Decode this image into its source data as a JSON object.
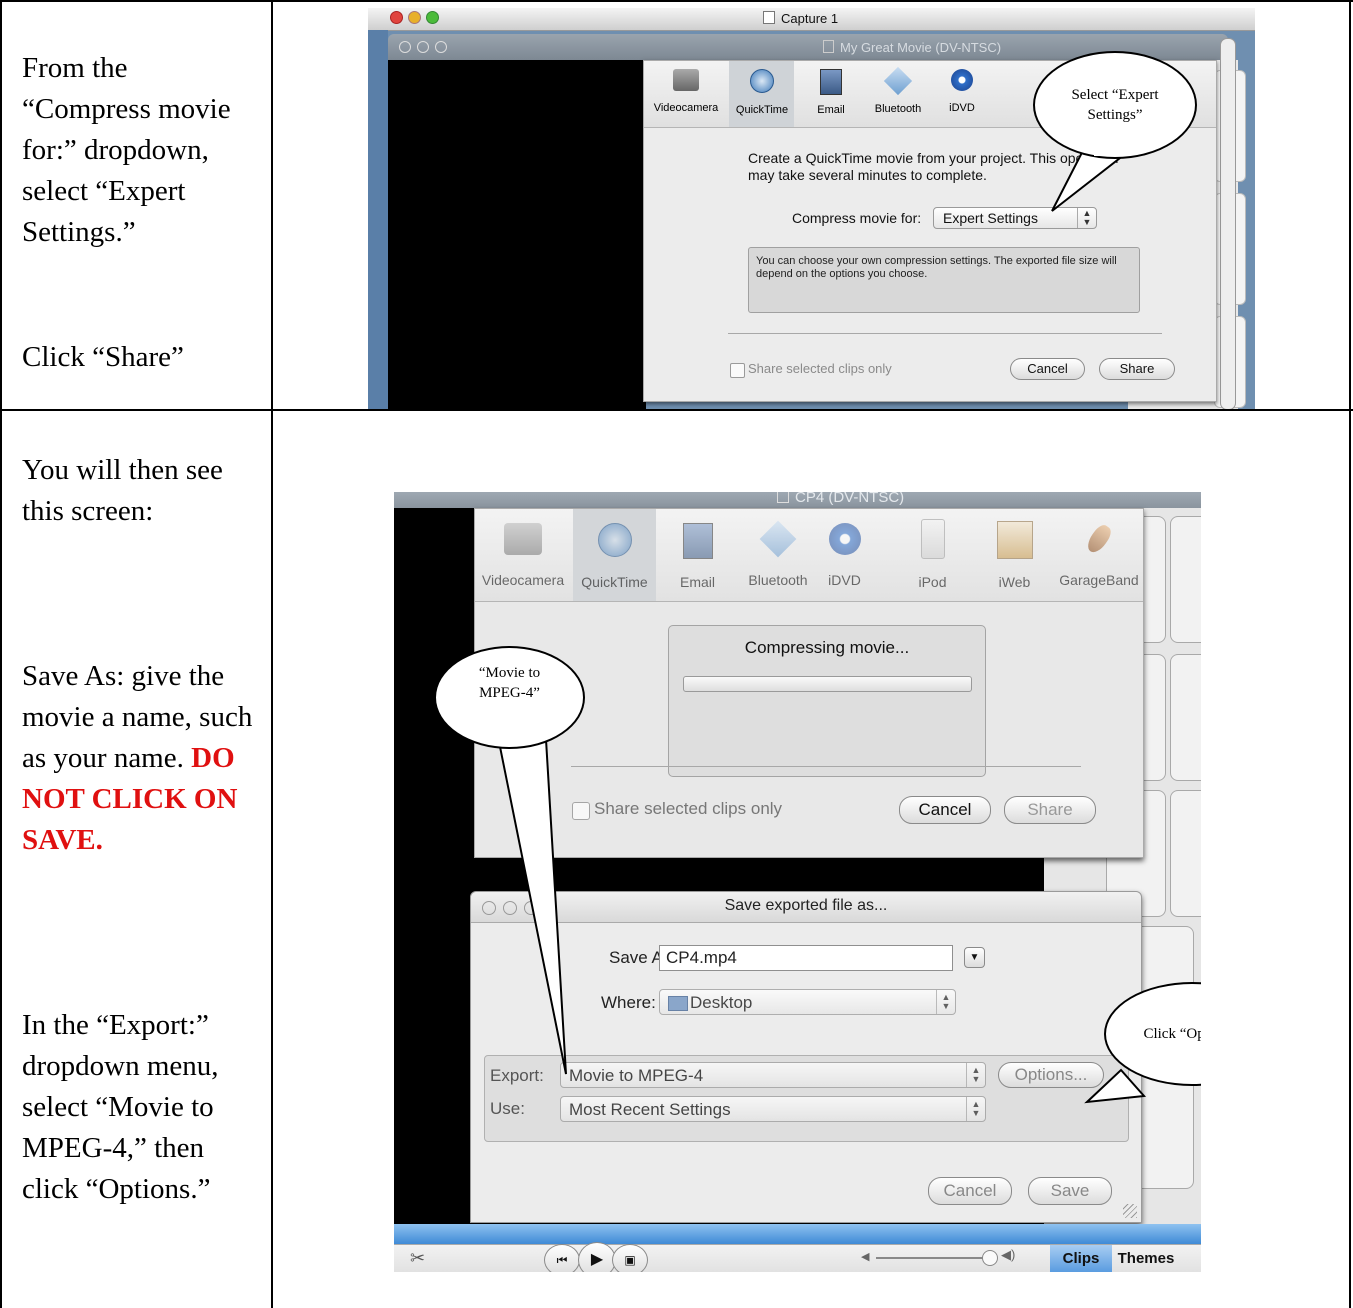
{
  "instructions": {
    "row1_compress": "From the “Compress movie for:” dropdown, select “Expert Settings.”",
    "row1_share": "Click “Share”",
    "row2_intro": "You will then see this screen:",
    "row2_save_as": "Save As:  give the movie a name, such as your name.",
    "row2_warning": "DO NOT CLICK ON SAVE.",
    "row2_export": "In the “Export:” dropdown menu, select “Movie to MPEG-4,” then click “Options.”"
  },
  "screenshot1": {
    "outer_title": "Capture 1",
    "window_title": "My Great Movie (DV-NTSC)",
    "toolbar": [
      "Videocamera",
      "QuickTime",
      "Email",
      "Bluetooth",
      "iDVD"
    ],
    "description": "Create a QuickTime movie from your project. This operation may take several minutes to complete.",
    "compress_label": "Compress movie for:",
    "compress_value": "Expert Settings",
    "info_text": "You can choose your own compression settings. The exported file size will depend on the options you choose.",
    "share_selected": "Share selected clips only",
    "cancel": "Cancel",
    "share": "Share",
    "callout": "Select “Expert Settings”"
  },
  "screenshot2": {
    "window_title": "CP4 (DV-NTSC)",
    "toolbar": [
      "Videocamera",
      "QuickTime",
      "Email",
      "Bluetooth",
      "iDVD",
      "iPod",
      "iWeb",
      "GarageBand"
    ],
    "compressing": "Compressing movie...",
    "progress": 0,
    "share_selected": "Share selected clips only",
    "cancel": "Cancel",
    "share": "Share",
    "save_dialog": {
      "title": "Save exported file as...",
      "save_as_label": "Save As:",
      "save_as_value": "CP4.mp4",
      "where_label": "Where:",
      "where_value": "Desktop",
      "export_label": "Export:",
      "export_value": "Movie to MPEG-4",
      "options": "Options...",
      "use_label": "Use:",
      "use_value": "Most Recent Settings",
      "cancel": "Cancel",
      "save": "Save"
    },
    "controls": {
      "clips": "Clips",
      "themes": "Themes"
    },
    "callout_movie": "“Movie to MPEG-4”",
    "callout_options": "Click “Options”"
  }
}
